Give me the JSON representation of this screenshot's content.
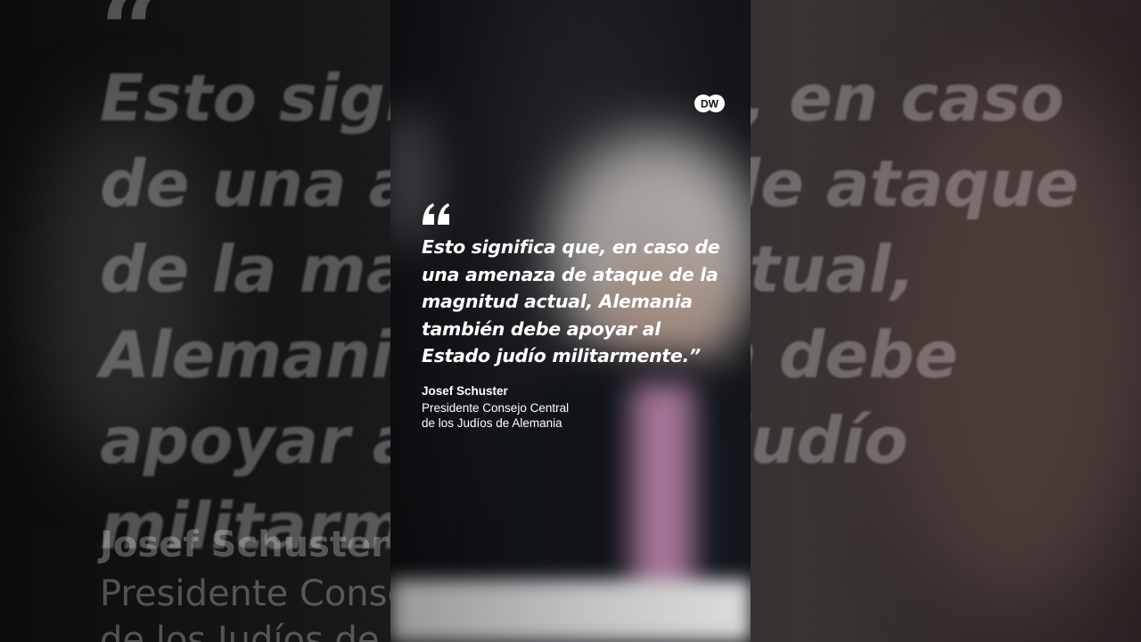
{
  "brand": {
    "logo_text": "DW"
  },
  "quote": {
    "text": "Esto significa que, en caso de una amenaza de ataque de la magnitud actual, Alemania también debe apoyar al Estado judío militarmente.”",
    "author": "Josef Schuster",
    "role_line1": "Presidente Consejo Central",
    "role_line2": "de los Judíos de Alemania"
  },
  "backdrop": {
    "text": "Esto significa que, en caso de una amenaza de ataque de la magnitud actual, Alemania también debe apoyar al Estado judío militarmente.”",
    "author": "Josef Schuster",
    "role_line1": "Presidente Consejo Central",
    "role_line2": "de los Judíos de Alemania"
  },
  "colors": {
    "text": "#ffffff",
    "tie_accent": "#c98fb8"
  }
}
